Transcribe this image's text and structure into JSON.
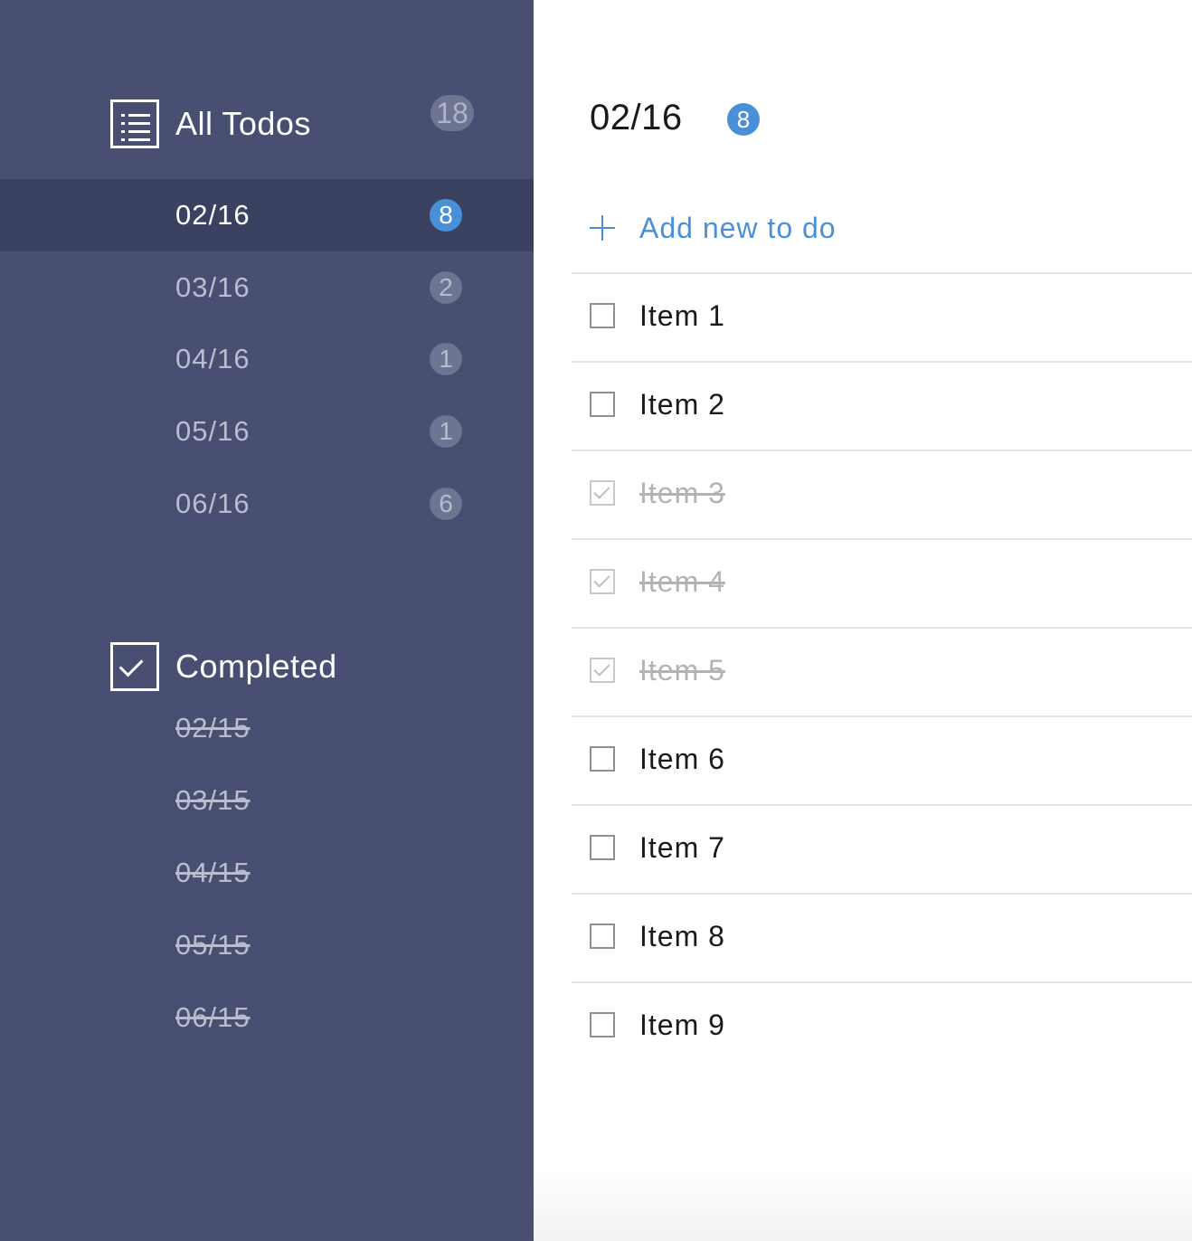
{
  "sidebar": {
    "all_todos": {
      "title": "All Todos",
      "count": "18"
    },
    "dates": [
      {
        "label": "02/16",
        "count": "8",
        "active": true
      },
      {
        "label": "03/16",
        "count": "2",
        "active": false
      },
      {
        "label": "04/16",
        "count": "1",
        "active": false
      },
      {
        "label": "05/16",
        "count": "1",
        "active": false
      },
      {
        "label": "06/16",
        "count": "6",
        "active": false
      }
    ],
    "completed": {
      "title": "Completed",
      "dates": [
        "02/15",
        "03/15",
        "04/15",
        "05/15",
        "06/15"
      ]
    }
  },
  "main": {
    "title": "02/16",
    "count": "8",
    "add_label": "Add new to do",
    "items": [
      {
        "label": "Item 1",
        "done": false
      },
      {
        "label": "Item 2",
        "done": false
      },
      {
        "label": "Item 3",
        "done": true
      },
      {
        "label": "Item 4",
        "done": true
      },
      {
        "label": "Item 5",
        "done": true
      },
      {
        "label": "Item 6",
        "done": false
      },
      {
        "label": "Item 7",
        "done": false
      },
      {
        "label": "Item 8",
        "done": false
      },
      {
        "label": "Item 9",
        "done": false
      }
    ]
  },
  "colors": {
    "sidebar_bg": "#484f72",
    "sidebar_active_bg": "#3b4160",
    "accent": "#4a90d9"
  }
}
